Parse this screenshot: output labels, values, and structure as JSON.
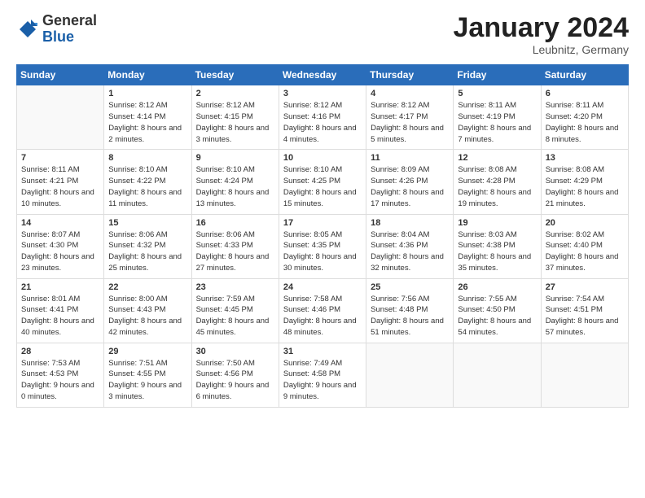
{
  "header": {
    "logo_general": "General",
    "logo_blue": "Blue",
    "month_title": "January 2024",
    "location": "Leubnitz, Germany"
  },
  "days_header": [
    "Sunday",
    "Monday",
    "Tuesday",
    "Wednesday",
    "Thursday",
    "Friday",
    "Saturday"
  ],
  "weeks": [
    [
      {
        "num": "",
        "sunrise": "",
        "sunset": "",
        "daylight": ""
      },
      {
        "num": "1",
        "sunrise": "Sunrise: 8:12 AM",
        "sunset": "Sunset: 4:14 PM",
        "daylight": "Daylight: 8 hours and 2 minutes."
      },
      {
        "num": "2",
        "sunrise": "Sunrise: 8:12 AM",
        "sunset": "Sunset: 4:15 PM",
        "daylight": "Daylight: 8 hours and 3 minutes."
      },
      {
        "num": "3",
        "sunrise": "Sunrise: 8:12 AM",
        "sunset": "Sunset: 4:16 PM",
        "daylight": "Daylight: 8 hours and 4 minutes."
      },
      {
        "num": "4",
        "sunrise": "Sunrise: 8:12 AM",
        "sunset": "Sunset: 4:17 PM",
        "daylight": "Daylight: 8 hours and 5 minutes."
      },
      {
        "num": "5",
        "sunrise": "Sunrise: 8:11 AM",
        "sunset": "Sunset: 4:19 PM",
        "daylight": "Daylight: 8 hours and 7 minutes."
      },
      {
        "num": "6",
        "sunrise": "Sunrise: 8:11 AM",
        "sunset": "Sunset: 4:20 PM",
        "daylight": "Daylight: 8 hours and 8 minutes."
      }
    ],
    [
      {
        "num": "7",
        "sunrise": "Sunrise: 8:11 AM",
        "sunset": "Sunset: 4:21 PM",
        "daylight": "Daylight: 8 hours and 10 minutes."
      },
      {
        "num": "8",
        "sunrise": "Sunrise: 8:10 AM",
        "sunset": "Sunset: 4:22 PM",
        "daylight": "Daylight: 8 hours and 11 minutes."
      },
      {
        "num": "9",
        "sunrise": "Sunrise: 8:10 AM",
        "sunset": "Sunset: 4:24 PM",
        "daylight": "Daylight: 8 hours and 13 minutes."
      },
      {
        "num": "10",
        "sunrise": "Sunrise: 8:10 AM",
        "sunset": "Sunset: 4:25 PM",
        "daylight": "Daylight: 8 hours and 15 minutes."
      },
      {
        "num": "11",
        "sunrise": "Sunrise: 8:09 AM",
        "sunset": "Sunset: 4:26 PM",
        "daylight": "Daylight: 8 hours and 17 minutes."
      },
      {
        "num": "12",
        "sunrise": "Sunrise: 8:08 AM",
        "sunset": "Sunset: 4:28 PM",
        "daylight": "Daylight: 8 hours and 19 minutes."
      },
      {
        "num": "13",
        "sunrise": "Sunrise: 8:08 AM",
        "sunset": "Sunset: 4:29 PM",
        "daylight": "Daylight: 8 hours and 21 minutes."
      }
    ],
    [
      {
        "num": "14",
        "sunrise": "Sunrise: 8:07 AM",
        "sunset": "Sunset: 4:30 PM",
        "daylight": "Daylight: 8 hours and 23 minutes."
      },
      {
        "num": "15",
        "sunrise": "Sunrise: 8:06 AM",
        "sunset": "Sunset: 4:32 PM",
        "daylight": "Daylight: 8 hours and 25 minutes."
      },
      {
        "num": "16",
        "sunrise": "Sunrise: 8:06 AM",
        "sunset": "Sunset: 4:33 PM",
        "daylight": "Daylight: 8 hours and 27 minutes."
      },
      {
        "num": "17",
        "sunrise": "Sunrise: 8:05 AM",
        "sunset": "Sunset: 4:35 PM",
        "daylight": "Daylight: 8 hours and 30 minutes."
      },
      {
        "num": "18",
        "sunrise": "Sunrise: 8:04 AM",
        "sunset": "Sunset: 4:36 PM",
        "daylight": "Daylight: 8 hours and 32 minutes."
      },
      {
        "num": "19",
        "sunrise": "Sunrise: 8:03 AM",
        "sunset": "Sunset: 4:38 PM",
        "daylight": "Daylight: 8 hours and 35 minutes."
      },
      {
        "num": "20",
        "sunrise": "Sunrise: 8:02 AM",
        "sunset": "Sunset: 4:40 PM",
        "daylight": "Daylight: 8 hours and 37 minutes."
      }
    ],
    [
      {
        "num": "21",
        "sunrise": "Sunrise: 8:01 AM",
        "sunset": "Sunset: 4:41 PM",
        "daylight": "Daylight: 8 hours and 40 minutes."
      },
      {
        "num": "22",
        "sunrise": "Sunrise: 8:00 AM",
        "sunset": "Sunset: 4:43 PM",
        "daylight": "Daylight: 8 hours and 42 minutes."
      },
      {
        "num": "23",
        "sunrise": "Sunrise: 7:59 AM",
        "sunset": "Sunset: 4:45 PM",
        "daylight": "Daylight: 8 hours and 45 minutes."
      },
      {
        "num": "24",
        "sunrise": "Sunrise: 7:58 AM",
        "sunset": "Sunset: 4:46 PM",
        "daylight": "Daylight: 8 hours and 48 minutes."
      },
      {
        "num": "25",
        "sunrise": "Sunrise: 7:56 AM",
        "sunset": "Sunset: 4:48 PM",
        "daylight": "Daylight: 8 hours and 51 minutes."
      },
      {
        "num": "26",
        "sunrise": "Sunrise: 7:55 AM",
        "sunset": "Sunset: 4:50 PM",
        "daylight": "Daylight: 8 hours and 54 minutes."
      },
      {
        "num": "27",
        "sunrise": "Sunrise: 7:54 AM",
        "sunset": "Sunset: 4:51 PM",
        "daylight": "Daylight: 8 hours and 57 minutes."
      }
    ],
    [
      {
        "num": "28",
        "sunrise": "Sunrise: 7:53 AM",
        "sunset": "Sunset: 4:53 PM",
        "daylight": "Daylight: 9 hours and 0 minutes."
      },
      {
        "num": "29",
        "sunrise": "Sunrise: 7:51 AM",
        "sunset": "Sunset: 4:55 PM",
        "daylight": "Daylight: 9 hours and 3 minutes."
      },
      {
        "num": "30",
        "sunrise": "Sunrise: 7:50 AM",
        "sunset": "Sunset: 4:56 PM",
        "daylight": "Daylight: 9 hours and 6 minutes."
      },
      {
        "num": "31",
        "sunrise": "Sunrise: 7:49 AM",
        "sunset": "Sunset: 4:58 PM",
        "daylight": "Daylight: 9 hours and 9 minutes."
      },
      {
        "num": "",
        "sunrise": "",
        "sunset": "",
        "daylight": ""
      },
      {
        "num": "",
        "sunrise": "",
        "sunset": "",
        "daylight": ""
      },
      {
        "num": "",
        "sunrise": "",
        "sunset": "",
        "daylight": ""
      }
    ]
  ]
}
